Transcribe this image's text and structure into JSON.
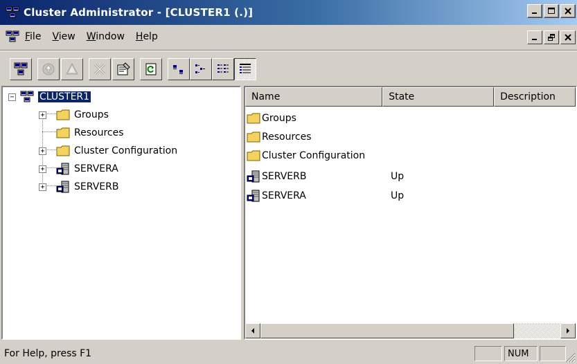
{
  "window": {
    "title": "Cluster Administrator - [CLUSTER1 (.)]",
    "controls": [
      "minimize-icon",
      "maximize-icon",
      "close-icon"
    ]
  },
  "menu": {
    "items": [
      {
        "label": "File",
        "mnemonic": "F",
        "rest": "ile"
      },
      {
        "label": "View",
        "mnemonic": "V",
        "rest": "iew"
      },
      {
        "label": "Window",
        "mnemonic": "W",
        "rest": "indow"
      },
      {
        "label": "Help",
        "mnemonic": "H",
        "rest": "elp"
      }
    ],
    "mdi_controls": [
      "minimize-icon",
      "restore-icon",
      "close-icon"
    ]
  },
  "toolbar": {
    "buttons": [
      "open-connection-icon",
      "bring-online-icon",
      "take-offline-icon",
      "delete-icon",
      "properties-icon",
      "refresh-icon",
      "large-icons-view-icon",
      "small-icons-view-icon",
      "list-view-icon",
      "details-view-icon"
    ],
    "pressed": "details-view-icon"
  },
  "tree": {
    "root": {
      "label": "CLUSTER1",
      "expander": "−"
    },
    "children": [
      {
        "label": "Groups",
        "icon": "folder-icon",
        "expander": "+"
      },
      {
        "label": "Resources",
        "icon": "folder-icon",
        "expander": ""
      },
      {
        "label": "Cluster Configuration",
        "icon": "folder-icon",
        "expander": "+"
      },
      {
        "label": "SERVERA",
        "icon": "server-icon",
        "expander": "+"
      },
      {
        "label": "SERVERB",
        "icon": "server-icon",
        "expander": "+"
      }
    ]
  },
  "list": {
    "columns": [
      "Name",
      "State",
      "Description"
    ],
    "rows": [
      {
        "name": "Groups",
        "state": "",
        "icon": "folder-icon"
      },
      {
        "name": "Resources",
        "state": "",
        "icon": "folder-icon"
      },
      {
        "name": "Cluster Configuration",
        "state": "",
        "icon": "folder-icon"
      },
      {
        "name": "SERVERB",
        "state": "Up",
        "icon": "server-icon"
      },
      {
        "name": "SERVERA",
        "state": "Up",
        "icon": "server-icon"
      }
    ]
  },
  "status": {
    "text": "For Help, press F1",
    "num": "NUM"
  },
  "colors": {
    "title_start": "#0a246a",
    "title_end": "#a6caf0",
    "selection": "#0a246a",
    "folder": "#f4d25e",
    "face": "#d4d0c8"
  }
}
